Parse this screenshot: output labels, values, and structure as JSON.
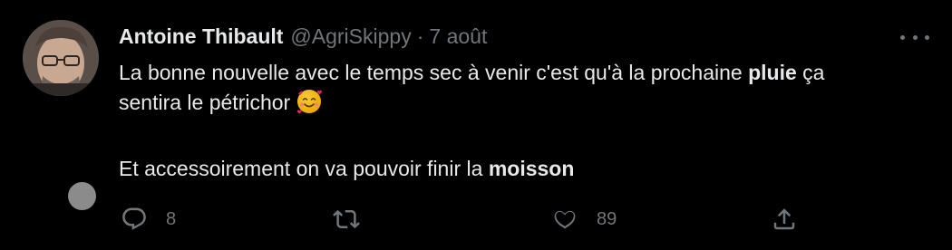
{
  "tweet": {
    "author_name": "Antoine Thibault",
    "author_handle": "@AgriSkippy",
    "separator": "·",
    "timestamp": "7 août",
    "line1_pre": "La bonne nouvelle avec le temps sec à venir c'est qu'à la prochaine ",
    "line1_bold": "pluie",
    "line1_post": " ça",
    "line2": "sentira le pétrichor",
    "emoji": "smiling-face-with-hearts",
    "line3_pre": "Et accessoirement on va pouvoir finir la ",
    "line3_bold": "moisson"
  },
  "actions": {
    "reply_count": "8",
    "like_count": "89"
  },
  "icons": {
    "more": "more-dots-icon",
    "reply": "reply-icon",
    "retweet": "retweet-icon",
    "like": "heart-icon",
    "share": "share-icon"
  },
  "colors": {
    "background": "#000000",
    "text": "#e7e9ea",
    "muted": "#71767b"
  }
}
